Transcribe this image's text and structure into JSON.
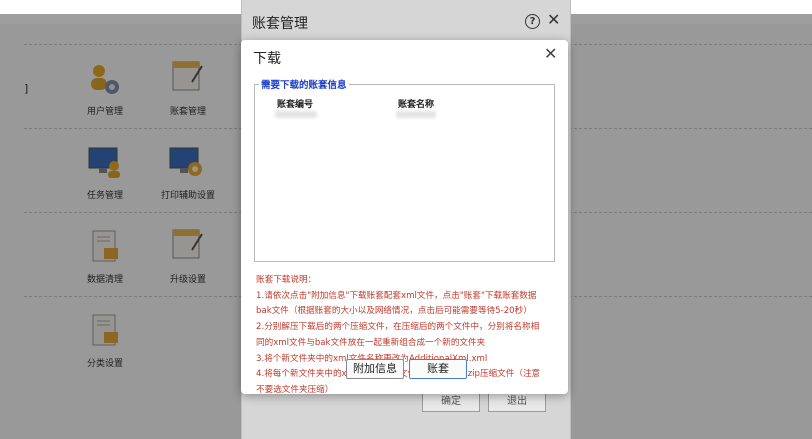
{
  "background": {
    "items": [
      {
        "label": "用户管理",
        "icon": "users-gear-icon"
      },
      {
        "label": "账套管理",
        "icon": "window-pencil-icon"
      },
      {
        "label": "任务管理",
        "icon": "monitor-user-icon"
      },
      {
        "label": "打印辅助设置",
        "icon": "monitor-gear-icon"
      },
      {
        "label": "数据清理",
        "icon": "document-lock-icon"
      },
      {
        "label": "升级设置",
        "icon": "window-pencil-icon"
      },
      {
        "label": "分类设置",
        "icon": "document-lock-icon"
      }
    ],
    "sidebar_mark": "]"
  },
  "outer_dialog": {
    "title": "账套管理",
    "help_glyph": "?",
    "close_glyph": "✕",
    "confirm_label": "确定",
    "exit_label": "退出"
  },
  "dialog": {
    "title": "下载",
    "close_glyph": "✕",
    "group_legend": "需要下载的账套信息",
    "columns": [
      "账套编号",
      "账套名称"
    ],
    "notes": [
      "账套下载说明：",
      "1.请依次点击\"附加信息\"下载账套配套xml文件，点击\"账套\"下载账套数据",
      "bak文件（根据账套的大小以及网络情况，点击后可能需要等待5-20秒）",
      "2.分别解压下载后的两个压缩文件，在压缩后的两个文件中，分别将名称相",
      "同的xml文件与bak文件放在一起重新组合成一个新的文件夹",
      "3.将个新文件夹中的xml文件名称更改为AdditionalXml.xml",
      "4.将每个新文件夹中的xml文件和bak文件选中并添加成zip压缩文件（注意",
      "不要选文件夹压缩）"
    ],
    "buttons": {
      "additional_info": "附加信息",
      "account_set": "账套"
    }
  },
  "colors": {
    "legend_blue": "#2040c8",
    "notes_red": "#c0392b",
    "primary_border": "#4a7fd0"
  }
}
